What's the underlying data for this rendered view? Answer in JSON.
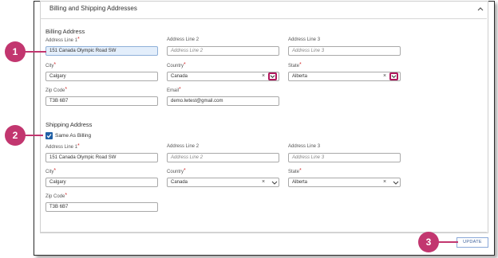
{
  "panel": {
    "title": "Billing and Shipping Addresses"
  },
  "billing": {
    "title": "Billing Address",
    "address1": {
      "label": "Address Line 1",
      "value": "151 Canada Olympic Road SW"
    },
    "address2": {
      "label": "Address Line 2",
      "placeholder": "Address Line 2"
    },
    "address3": {
      "label": "Address Line 3",
      "placeholder": "Address Line 3"
    },
    "city": {
      "label": "City",
      "value": "Calgary"
    },
    "country": {
      "label": "Country",
      "value": "Canada"
    },
    "state": {
      "label": "State",
      "value": "Alberta"
    },
    "zip": {
      "label": "Zip Code",
      "value": "T3B 6B7"
    },
    "email": {
      "label": "Email",
      "value": "demo.lwtest@gmail.com"
    }
  },
  "shipping": {
    "title": "Shipping Address",
    "same_as_billing": "Same As Billing",
    "address1": {
      "label": "Address Line 1",
      "value": "151 Canada Olympic Road SW"
    },
    "address2": {
      "label": "Address Line 2",
      "placeholder": "Address Line 2"
    },
    "address3": {
      "label": "Address Line 3",
      "placeholder": "Address Line 3"
    },
    "city": {
      "label": "City",
      "value": "Calgary"
    },
    "country": {
      "label": "Country",
      "value": "Canada"
    },
    "state": {
      "label": "State",
      "value": "Alberta"
    },
    "zip": {
      "label": "Zip Code",
      "value": "T3B 6B7"
    }
  },
  "required_marker": "*",
  "clear_glyph": "×",
  "update_label": "UPDATE",
  "callouts": [
    "1",
    "2",
    "3"
  ],
  "colors": {
    "accent": "#c2366f",
    "checkbox": "#1f5fa5",
    "highlight": "#e3eefb"
  }
}
